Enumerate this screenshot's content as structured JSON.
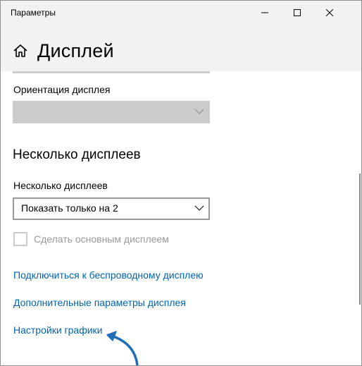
{
  "window": {
    "title": "Параметры",
    "controls": {
      "minimize": "minimize-icon",
      "maximize": "maximize-icon",
      "close": "close-icon"
    }
  },
  "header": {
    "home_icon": "home-icon",
    "title": "Дисплей"
  },
  "orientation": {
    "label": "Ориентация дисплея",
    "value": "",
    "disabled": true
  },
  "multiple_displays": {
    "heading": "Несколько дисплеев",
    "label": "Несколько дисплеев",
    "selected": "Показать только на 2",
    "checkbox_label": "Сделать основным дисплеем",
    "checkbox_checked": false,
    "checkbox_disabled": true
  },
  "links": [
    "Подключиться к беспроводному дисплею",
    "Дополнительные параметры дисплея",
    "Настройки графики"
  ],
  "colors": {
    "accent_link": "#0063b1",
    "arrow": "#1f6fb8",
    "disabled_control": "#cccccc",
    "titlebar_bg": "#f2f2f2"
  }
}
